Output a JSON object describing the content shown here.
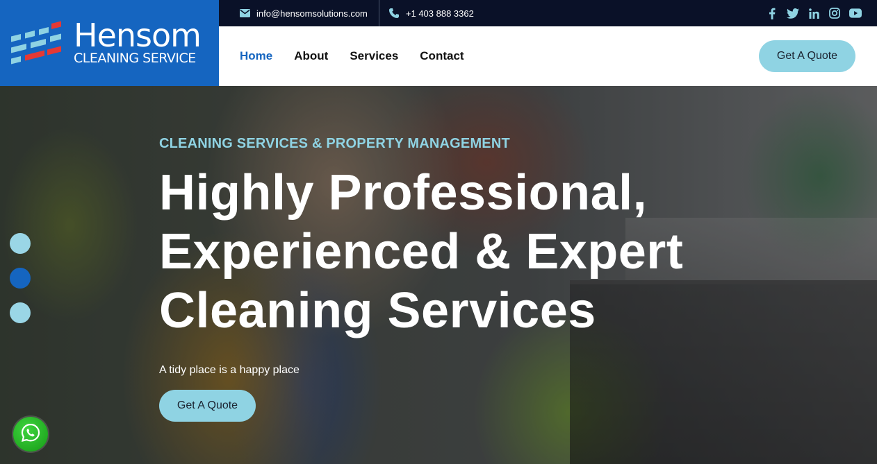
{
  "topbar": {
    "email": "info@hensomsolutions.com",
    "phone": "+1 403 888 3362",
    "socials": [
      "facebook-icon",
      "twitter-icon",
      "linkedin-icon",
      "instagram-icon",
      "youtube-icon"
    ]
  },
  "logo": {
    "brand": "Hensom",
    "tagline": "CLEANING SERVICE"
  },
  "nav": {
    "items": [
      {
        "label": "Home",
        "active": true
      },
      {
        "label": "About",
        "active": false
      },
      {
        "label": "Services",
        "active": false
      },
      {
        "label": "Contact",
        "active": false
      }
    ],
    "quote_label": "Get A Quote"
  },
  "hero": {
    "kicker": "CLEANING SERVICES & PROPERTY MANAGEMENT",
    "title_line1": "Highly Professional,",
    "title_line2": "Experienced & Expert",
    "title_line3": "Cleaning Services",
    "subtitle": "A tidy place is a happy place",
    "cta_label": "Get A Quote"
  },
  "slider": {
    "count": 3,
    "active_index": 1
  },
  "colors": {
    "brand_blue": "#1565c0",
    "accent_cyan": "#8fd3e3",
    "topbar_bg": "#0a1128",
    "whatsapp_green": "#25d366"
  }
}
